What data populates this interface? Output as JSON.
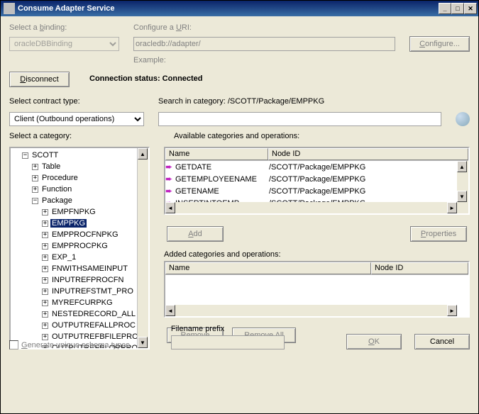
{
  "window": {
    "title": "Consume Adapter Service"
  },
  "labels": {
    "selectBinding": "Select a binding:",
    "bindingLetter": "b",
    "configureUri": "Configure a URI:",
    "uriLetter": "U",
    "example": "Example:",
    "disconnect": "Disconnect",
    "disconnectLetter": "D",
    "connStatusLabel": "Connection status:",
    "connStatusValue": " Connected",
    "selectContract": "Select contract type:",
    "searchInCat": "Search in category: /SCOTT/Package/EMPPKG",
    "selectCategory": "Select a category:",
    "availOps": "Available categories and operations:",
    "addedOps": "Added categories and operations:",
    "add": "Add",
    "addLetter": "A",
    "properties": "Properties",
    "propLetter": "P",
    "remove": "Remove",
    "removeLetter": "R",
    "removeAll": "Remove All",
    "removeAllLetter": "l",
    "filenamePrefix": "Filename prefix",
    "genUnique": "Generate unique schema types",
    "genLetter": "G",
    "ok": "OK",
    "okLetter": "O",
    "cancel": "Cancel",
    "configure": "Configure...",
    "configLetter": "C"
  },
  "fields": {
    "binding": "oracleDBBinding",
    "uri": "oracledb://adapter/",
    "contractType": "Client (Outbound operations)",
    "search": "",
    "filenamePrefix": ""
  },
  "tree": {
    "root": "SCOTT",
    "children": [
      "Table",
      "Procedure",
      "Function",
      "Package"
    ],
    "packageItems": [
      "EMPFNPKG",
      "EMPPKG",
      "EMPPROCFNPKG",
      "EMPPROCPKG",
      "EXP_1",
      "FNWITHSAMEINPUT",
      "INPUTREFPROCFN",
      "INPUTREFSTMT_PRO",
      "MYREFCURPKG",
      "NESTEDRECORD_ALL",
      "OUTPUTREFALLPROC",
      "OUTPUTREFBFILEPROC",
      "OUTPUTREFBLORPROC"
    ],
    "selected": "EMPPKG"
  },
  "available": {
    "cols": {
      "name": "Name",
      "nodeId": "Node ID"
    },
    "items": [
      {
        "name": "GETDATE",
        "nodeId": "/SCOTT/Package/EMPPKG"
      },
      {
        "name": "GETEMPLOYEENAME",
        "nodeId": "/SCOTT/Package/EMPPKG"
      },
      {
        "name": "GETENAME",
        "nodeId": "/SCOTT/Package/EMPPKG"
      },
      {
        "name": "INSERTINTOEMP",
        "nodeId": "/SCOTT/Package/EMPPKG"
      }
    ]
  },
  "added": {
    "cols": {
      "name": "Name",
      "nodeId": "Node ID"
    }
  }
}
